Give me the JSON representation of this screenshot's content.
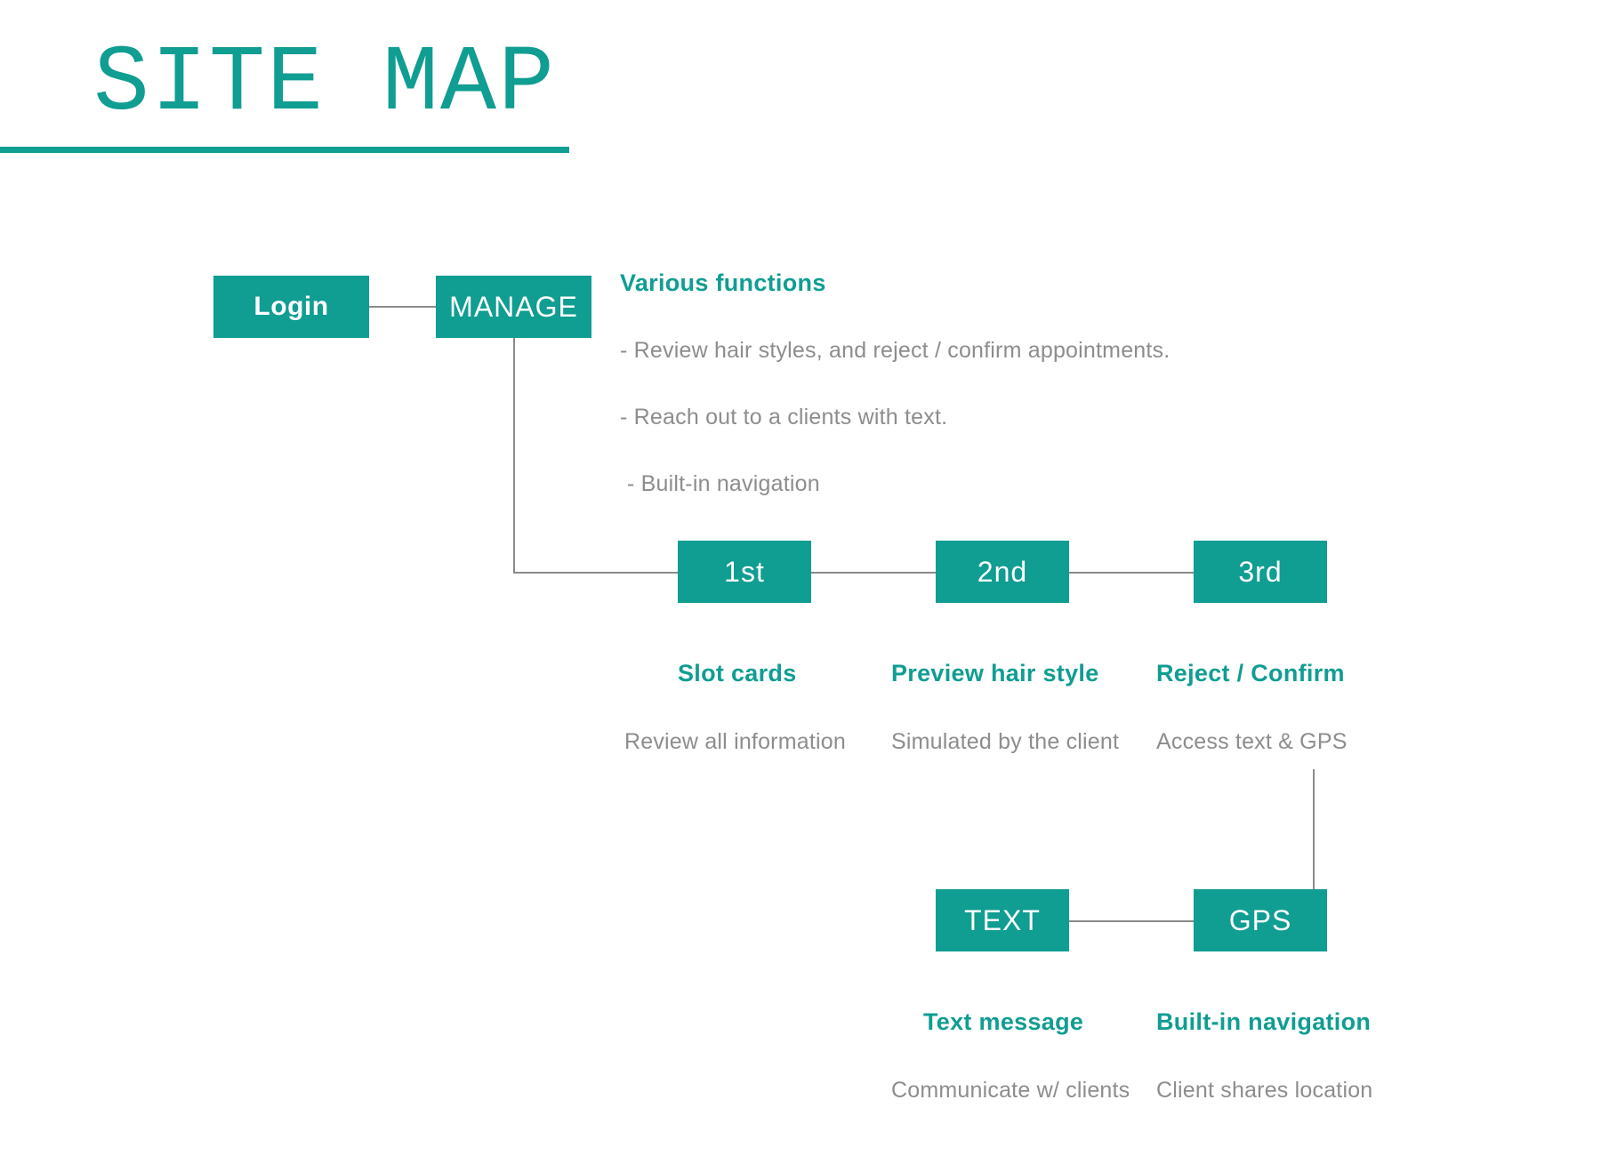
{
  "title": "SITE MAP",
  "nodes": {
    "login": "Login",
    "manage": "MANAGE",
    "first": "1st",
    "second": "2nd",
    "third": "3rd",
    "text": "TEXT",
    "gps": "GPS"
  },
  "manage_section": {
    "heading": "Various functions",
    "line1": "- Review hair styles, and reject / confirm appointments.",
    "line2": "- Reach out to a clients with text.",
    "line3": "- Built-in navigation"
  },
  "first_section": {
    "heading": "Slot cards",
    "sub": "Review all information"
  },
  "second_section": {
    "heading": "Preview hair style",
    "sub": "Simulated by the client"
  },
  "third_section": {
    "heading": "Reject / Confirm",
    "sub": "Access text & GPS"
  },
  "text_section": {
    "heading": "Text message",
    "sub": "Communicate w/ clients"
  },
  "gps_section": {
    "heading": "Built-in navigation",
    "sub": "Client shares location"
  }
}
